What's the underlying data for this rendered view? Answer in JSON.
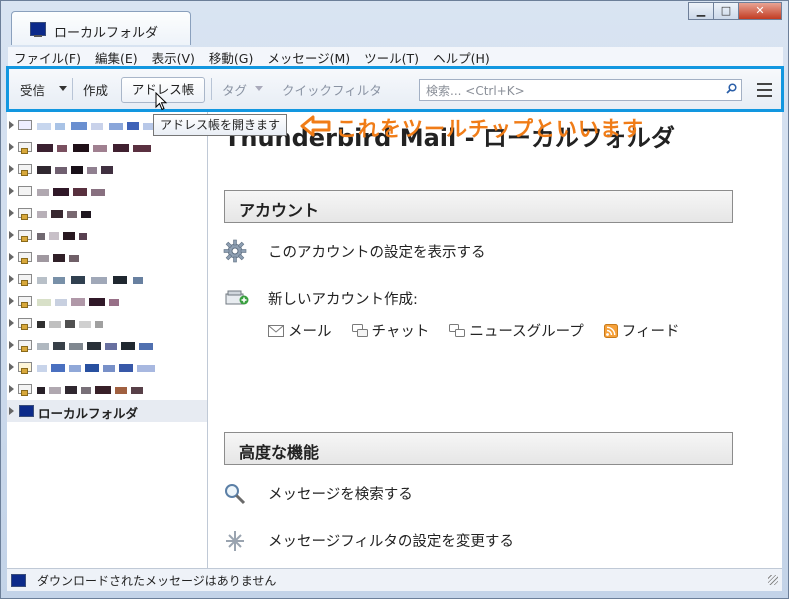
{
  "window": {
    "tab_title": "ローカルフォルダ",
    "controls": {
      "minimize": "▁",
      "maximize": "□",
      "close": "✕"
    }
  },
  "menubar": [
    "ファイル(F)",
    "編集(E)",
    "表示(V)",
    "移動(G)",
    "メッセージ(M)",
    "ツール(T)",
    "ヘルプ(H)"
  ],
  "toolbar": {
    "receive": "受信",
    "compose": "作成",
    "address_book": "アドレス帳",
    "tag": "タグ",
    "quick_filter": "クイックフィルタ",
    "search_placeholder": "検索... <Ctrl+K>"
  },
  "tooltip": "アドレス帳を開きます",
  "annotation": "これをツールチップといいます",
  "folders": {
    "local_folder": "ローカルフォルダ"
  },
  "content": {
    "title": "Thunderbird Mail - ローカルフォルダ",
    "account_section": "アカウント",
    "view_settings": "このアカウントの設定を表示する",
    "new_account": "新しいアカウント作成:",
    "account_types": [
      "メール",
      "チャット",
      "ニュースグループ",
      "フィード"
    ],
    "advanced_section": "高度な機能",
    "search_messages": "メッセージを検索する",
    "message_filters": "メッセージフィルタの設定を変更する"
  },
  "status": {
    "text": "ダウンロードされたメッセージはありません"
  },
  "colors": {
    "highlight": "#1297e0",
    "annotation": "#f07c17"
  }
}
